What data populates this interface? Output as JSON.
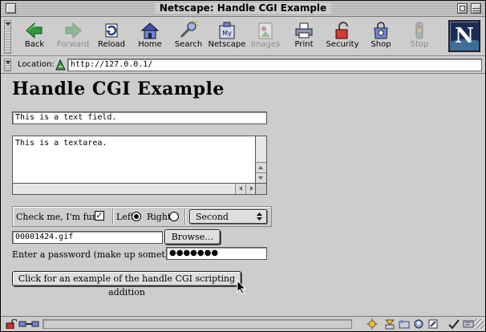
{
  "window": {
    "title": "Netscape: Handle CGI Example"
  },
  "toolbar": {
    "buttons": [
      {
        "label": "Back",
        "icon": "back-arrow-icon",
        "enabled": true
      },
      {
        "label": "Forward",
        "icon": "forward-arrow-icon",
        "enabled": false
      },
      {
        "label": "Reload",
        "icon": "reload-icon",
        "enabled": true
      },
      {
        "label": "Home",
        "icon": "home-icon",
        "enabled": true
      },
      {
        "label": "Search",
        "icon": "search-icon",
        "enabled": true
      },
      {
        "label": "Netscape",
        "icon": "my-netscape-icon",
        "enabled": true
      },
      {
        "label": "Images",
        "icon": "images-icon",
        "enabled": false
      },
      {
        "label": "Print",
        "icon": "print-icon",
        "enabled": true
      },
      {
        "label": "Security",
        "icon": "security-lock-icon",
        "enabled": true
      },
      {
        "label": "Shop",
        "icon": "shop-bag-icon",
        "enabled": true
      },
      {
        "label": "Stop",
        "icon": "stop-icon",
        "enabled": false
      }
    ],
    "logo_letter": "N"
  },
  "location": {
    "label": "Location:",
    "url": "http://127.0.0.1/"
  },
  "page": {
    "title": "Handle CGI Example",
    "text_field": "This is a text field.",
    "textarea": "This is a textarea.",
    "checkbox": {
      "label": "Check me, I'm fun!",
      "checked": true,
      "mark": "✓"
    },
    "radio_left": {
      "label": "Left",
      "checked": true
    },
    "radio_right": {
      "label": "Right",
      "checked": false
    },
    "select": {
      "value": "Second"
    },
    "file_field": "00001424.gif",
    "browse_label": "Browse…",
    "password_label": "Enter a password (make up something):",
    "password_value": "●●●●●●●",
    "submit_label": "Click for an example of the handle CGI scripting addition"
  },
  "colors": {
    "chrome": "#cccccc",
    "logo_bg": "#1a2d55"
  }
}
